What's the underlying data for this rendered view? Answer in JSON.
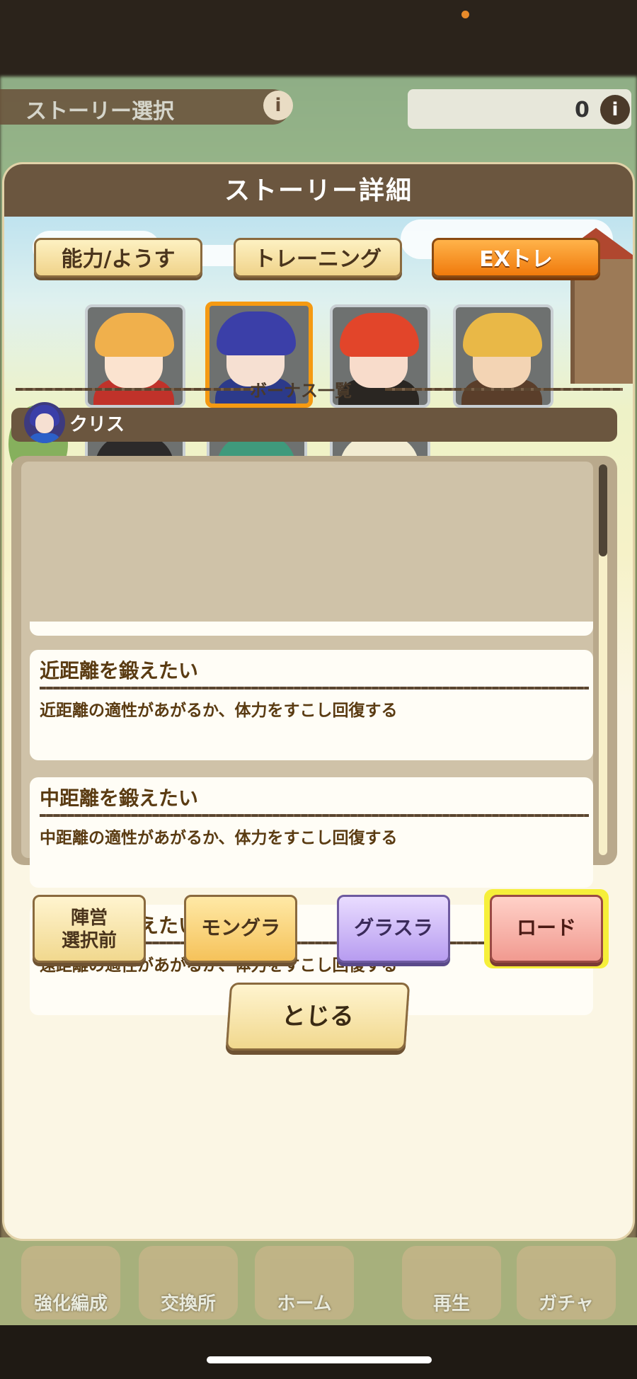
{
  "background": {
    "story_select_title": "ストーリー選択",
    "resource_count": "0",
    "bottom_nav": [
      "強化編成",
      "交換所",
      "ホーム",
      "再生",
      "ガチャ"
    ]
  },
  "modal": {
    "title": "ストーリー詳細",
    "tabs": [
      {
        "label": "能力/ようす",
        "active": false
      },
      {
        "label": "トレーニング",
        "active": false
      },
      {
        "label": "EXトレ",
        "active": true
      }
    ],
    "characters": [
      {
        "id": "char-1",
        "selected": false,
        "hair": "#f0b04c",
        "skin": "#fbe3cf",
        "outfit": "#c0322a"
      },
      {
        "id": "char-2",
        "selected": true,
        "hair": "#3b3fa8",
        "skin": "#f6e0d2",
        "outfit": "#2c3a8a"
      },
      {
        "id": "char-3",
        "selected": false,
        "hair": "#e2452a",
        "skin": "#f8dccb",
        "outfit": "#2a2622"
      },
      {
        "id": "char-4",
        "selected": false,
        "hair": "#e9b847",
        "skin": "#f3d4b4",
        "outfit": "#5a3e2a"
      },
      {
        "id": "char-5",
        "selected": false,
        "hair": "#2c2a2a",
        "skin": "#efd3bd",
        "outfit": "#1f1f24"
      },
      {
        "id": "char-6",
        "selected": false,
        "hair": "#3f9a7c",
        "skin": "#e8cdb5",
        "outfit": "#2a3a36"
      },
      {
        "id": "char-7",
        "selected": false,
        "hair": "#f2ecd2",
        "skin": "#f8e4d6",
        "outfit": "#1a1a2a"
      }
    ],
    "bonus_label": "ボーナス一覧",
    "selected_character_name": "クリス",
    "bonuses": [
      {
        "title": "近距離を鍛えたい",
        "description": "近距離の適性があがるか、体力をすこし回復する"
      },
      {
        "title": "中距離を鍛えたい",
        "description": "中距離の適性があがるか、体力をすこし回復する"
      },
      {
        "title": "遠距離を鍛えたい",
        "description": "遠距離の適性があがるか、体力をすこし回復する"
      }
    ],
    "buttons": {
      "camp_line1": "陣営",
      "camp_line2": "選択前",
      "mongura": "モングラ",
      "grasura": "グラスラ",
      "load": "ロード",
      "close": "とじる"
    }
  },
  "colors": {
    "accent_orange": "#f07a0c",
    "header_brown": "#6b563f",
    "selected_border": "#f59a12"
  }
}
